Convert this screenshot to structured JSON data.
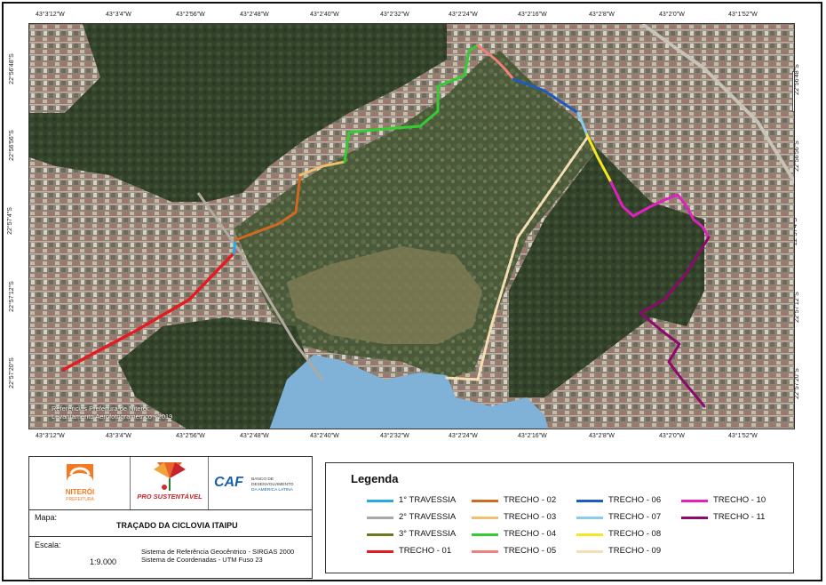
{
  "coords": {
    "lon_labels": [
      "43°3'12\"W",
      "43°3'4\"W",
      "43°2'56\"W",
      "43°2'48\"W",
      "43°2'40\"W",
      "43°2'32\"W",
      "43°2'24\"W",
      "43°2'16\"W",
      "43°2'8\"W",
      "43°2'0\"W",
      "43°1'52\"W"
    ],
    "lat_labels": [
      "22°56'48\"S",
      "22°56'56\"S",
      "22°57'4\"S",
      "22°57'12\"S",
      "22°57'20\"S"
    ]
  },
  "map": {
    "credit_line1": "Referências Prefeitura de Niterói:",
    "credit_line2": "Levantamento Aerofotogramétrico - 2019",
    "north_label": "N",
    "colors": {
      "vegetation": "#3a4a2e",
      "urban": "#8a7a6a",
      "lagoon": "#7fb2d6"
    }
  },
  "info": {
    "logo1_text": "NITERÓI",
    "logo1_sub": "PREFEITURA",
    "logo2_text": "PRO SUSTENTÁVEL",
    "logo3_text": "CAF",
    "logo3_sub1": "BANCO DE DESENVOLVIMENTO",
    "logo3_sub2": "DA AMÉRICA LATINA",
    "map_label": "Mapa:",
    "map_title": "TRAÇADO DA CICLOVIA ITAIPU",
    "scale_label": "Escala:",
    "scale_value": "1:9.000",
    "sys_line1": "Sistema de Referência Geocêntrico - SIRGAS 2000",
    "sys_line2": "Sistema de Coordenadas - UTM Fuso 23"
  },
  "legend": {
    "title": "Legenda",
    "items": [
      {
        "label": "1° TRAVESSIA",
        "color": "#27a9e1"
      },
      {
        "label": "2° TRAVESSIA",
        "color": "#a8a8a8"
      },
      {
        "label": "3° TRAVESSIA",
        "color": "#6b7a1f"
      },
      {
        "label": "TRECHO - 01",
        "color": "#e31b23"
      },
      {
        "label": "TRECHO - 02",
        "color": "#d2691e"
      },
      {
        "label": "TRECHO - 03",
        "color": "#f0c070"
      },
      {
        "label": "TRECHO - 04",
        "color": "#33cc33"
      },
      {
        "label": "TRECHO - 05",
        "color": "#f08080"
      },
      {
        "label": "TRECHO - 06",
        "color": "#1f5bbf"
      },
      {
        "label": "TRECHO - 07",
        "color": "#87ceeb"
      },
      {
        "label": "TRECHO - 08",
        "color": "#f5e623"
      },
      {
        "label": "TRECHO - 09",
        "color": "#f5deb3"
      },
      {
        "label": "TRECHO - 10",
        "color": "#e020c0"
      },
      {
        "label": "TRECHO - 11",
        "color": "#8b0a6b"
      }
    ]
  }
}
